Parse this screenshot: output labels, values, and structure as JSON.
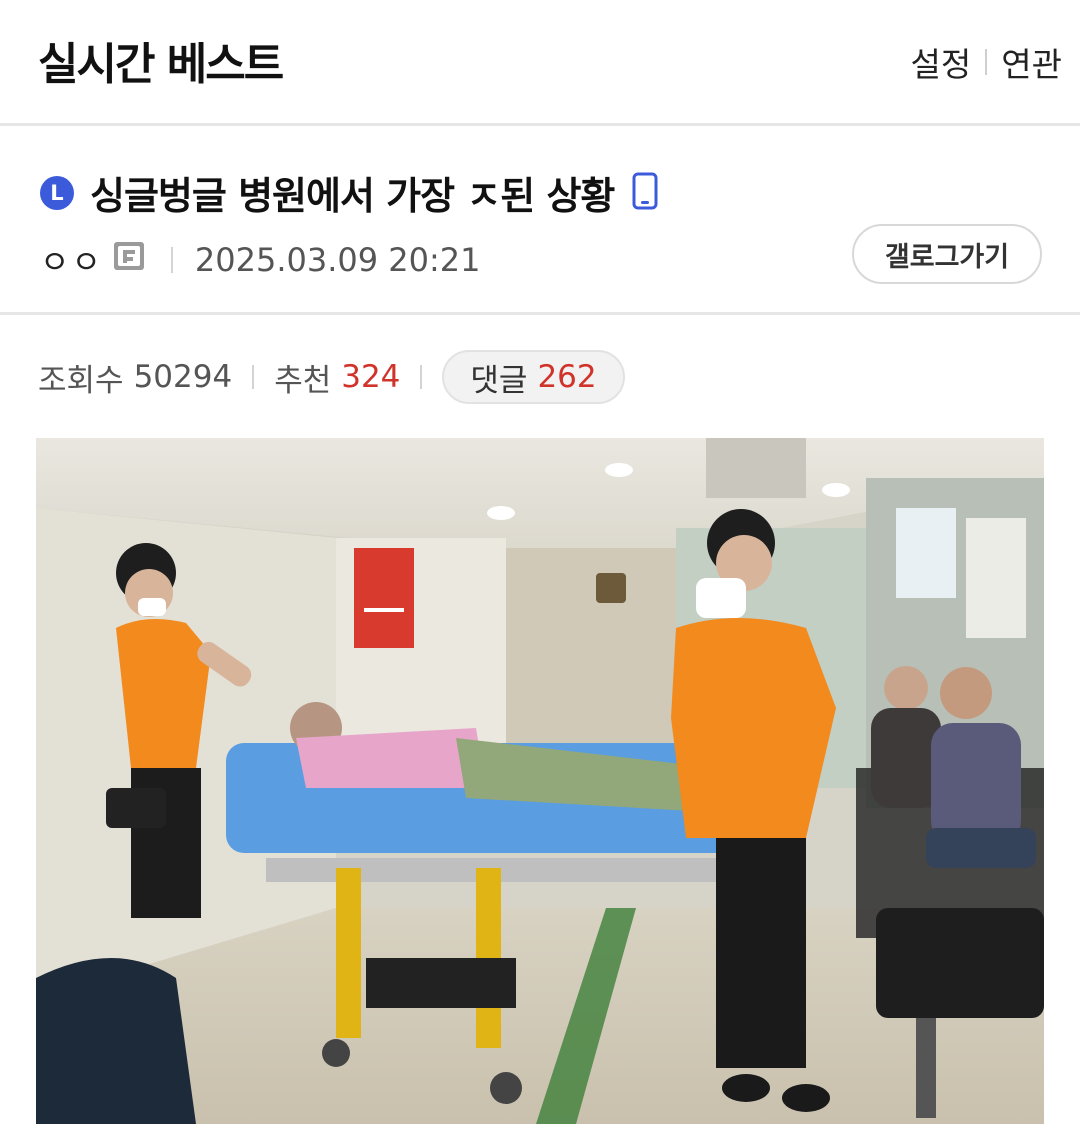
{
  "header": {
    "title": "실시간 베스트",
    "settings_label": "설정",
    "related_label": "연관"
  },
  "post": {
    "badge": "L",
    "title": "싱글벙글 병원에서 가장 ㅈ된 상황",
    "author": "ㅇㅇ",
    "date": "2025.03.09 20:21",
    "gallery_button": "갤로그가기",
    "icons": [
      "mobile-phone-icon",
      "fixed-nick-icon"
    ]
  },
  "stats": {
    "views_label": "조회수",
    "views": "50294",
    "recommend_label": "추천",
    "recommend": "324",
    "comments_label": "댓글",
    "comments": "262"
  },
  "colors": {
    "accent_blue": "#3b5bdb",
    "count_red": "#d0332a",
    "divider": "#e6e6e6"
  }
}
